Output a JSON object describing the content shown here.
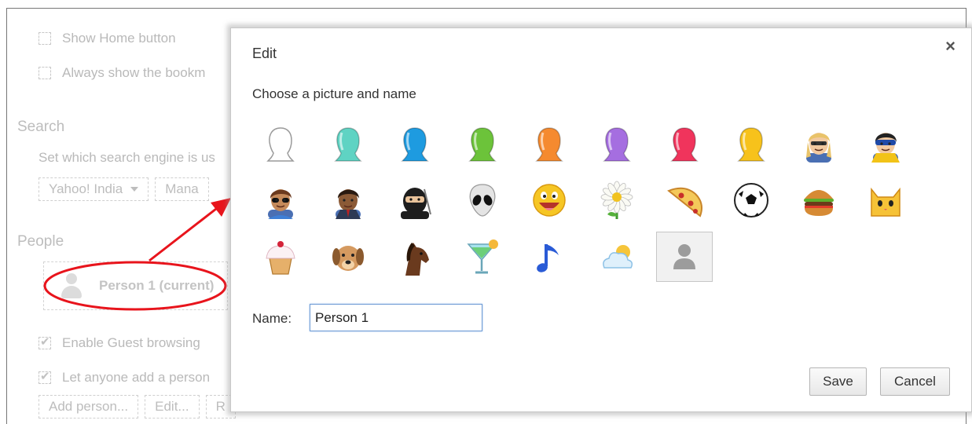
{
  "background": {
    "show_home_button": "Show Home button",
    "always_show_bookmarks": "Always show the bookm",
    "search_title": "Search",
    "search_desc": "Set which search engine is us",
    "search_engine_value": "Yahoo! India",
    "manage_button": "Mana",
    "people_title": "People",
    "person_current": "Person 1 (current)",
    "enable_guest": "Enable Guest browsing",
    "let_anyone_add": "Let anyone add a person",
    "add_person_button": "Add person...",
    "edit_button": "Edit...",
    "remove_button": "R"
  },
  "dialog": {
    "title": "Edit",
    "close_label": "×",
    "subtitle": "Choose a picture and name",
    "name_label": "Name:",
    "name_value": "Person 1",
    "save_label": "Save",
    "cancel_label": "Cancel"
  },
  "avatars": [
    {
      "name": "white-silhouette-avatar",
      "color": "#ffffff"
    },
    {
      "name": "cyan-silhouette-avatar",
      "color": "#5fd3c3"
    },
    {
      "name": "blue-silhouette-avatar",
      "color": "#1e9be0"
    },
    {
      "name": "green-silhouette-avatar",
      "color": "#6cc33a"
    },
    {
      "name": "orange-silhouette-avatar",
      "color": "#f58a2f"
    },
    {
      "name": "purple-silhouette-avatar",
      "color": "#a56ee0"
    },
    {
      "name": "red-silhouette-avatar",
      "color": "#f0345c"
    },
    {
      "name": "yellow-silhouette-avatar",
      "color": "#f7c21b"
    },
    {
      "name": "blonde-woman-avatar",
      "color": "#e9c36a"
    },
    {
      "name": "superhero-avatar",
      "color": "#3b6bc2"
    },
    {
      "name": "woman-sunglasses-avatar",
      "color": "#8a5630"
    },
    {
      "name": "businessman-avatar",
      "color": "#6b4226"
    },
    {
      "name": "ninja-avatar",
      "color": "#222222"
    },
    {
      "name": "alien-avatar",
      "color": "#dddddd"
    },
    {
      "name": "smiley-avatar",
      "color": "#f6c624"
    },
    {
      "name": "flower-avatar",
      "color": "#f6f6f0"
    },
    {
      "name": "pizza-avatar",
      "color": "#f1c24c"
    },
    {
      "name": "soccer-ball-avatar",
      "color": "#111111"
    },
    {
      "name": "burger-avatar",
      "color": "#d68a34"
    },
    {
      "name": "cat-avatar",
      "color": "#f6c237"
    },
    {
      "name": "cupcake-avatar",
      "color": "#f0ccd6"
    },
    {
      "name": "dog-avatar",
      "color": "#c68b52"
    },
    {
      "name": "horse-avatar",
      "color": "#6a3a1e"
    },
    {
      "name": "cocktail-avatar",
      "color": "#7ec8d8"
    },
    {
      "name": "music-note-avatar",
      "color": "#2a5bd6"
    },
    {
      "name": "sun-cloud-avatar",
      "color": "#9ccdf0"
    },
    {
      "name": "generic-person-avatar",
      "color": "#9c9c9c"
    }
  ],
  "selected_avatar": "generic-person-avatar",
  "colors": {
    "annotation_red": "#e8141c",
    "input_border": "#6f9bd5"
  }
}
